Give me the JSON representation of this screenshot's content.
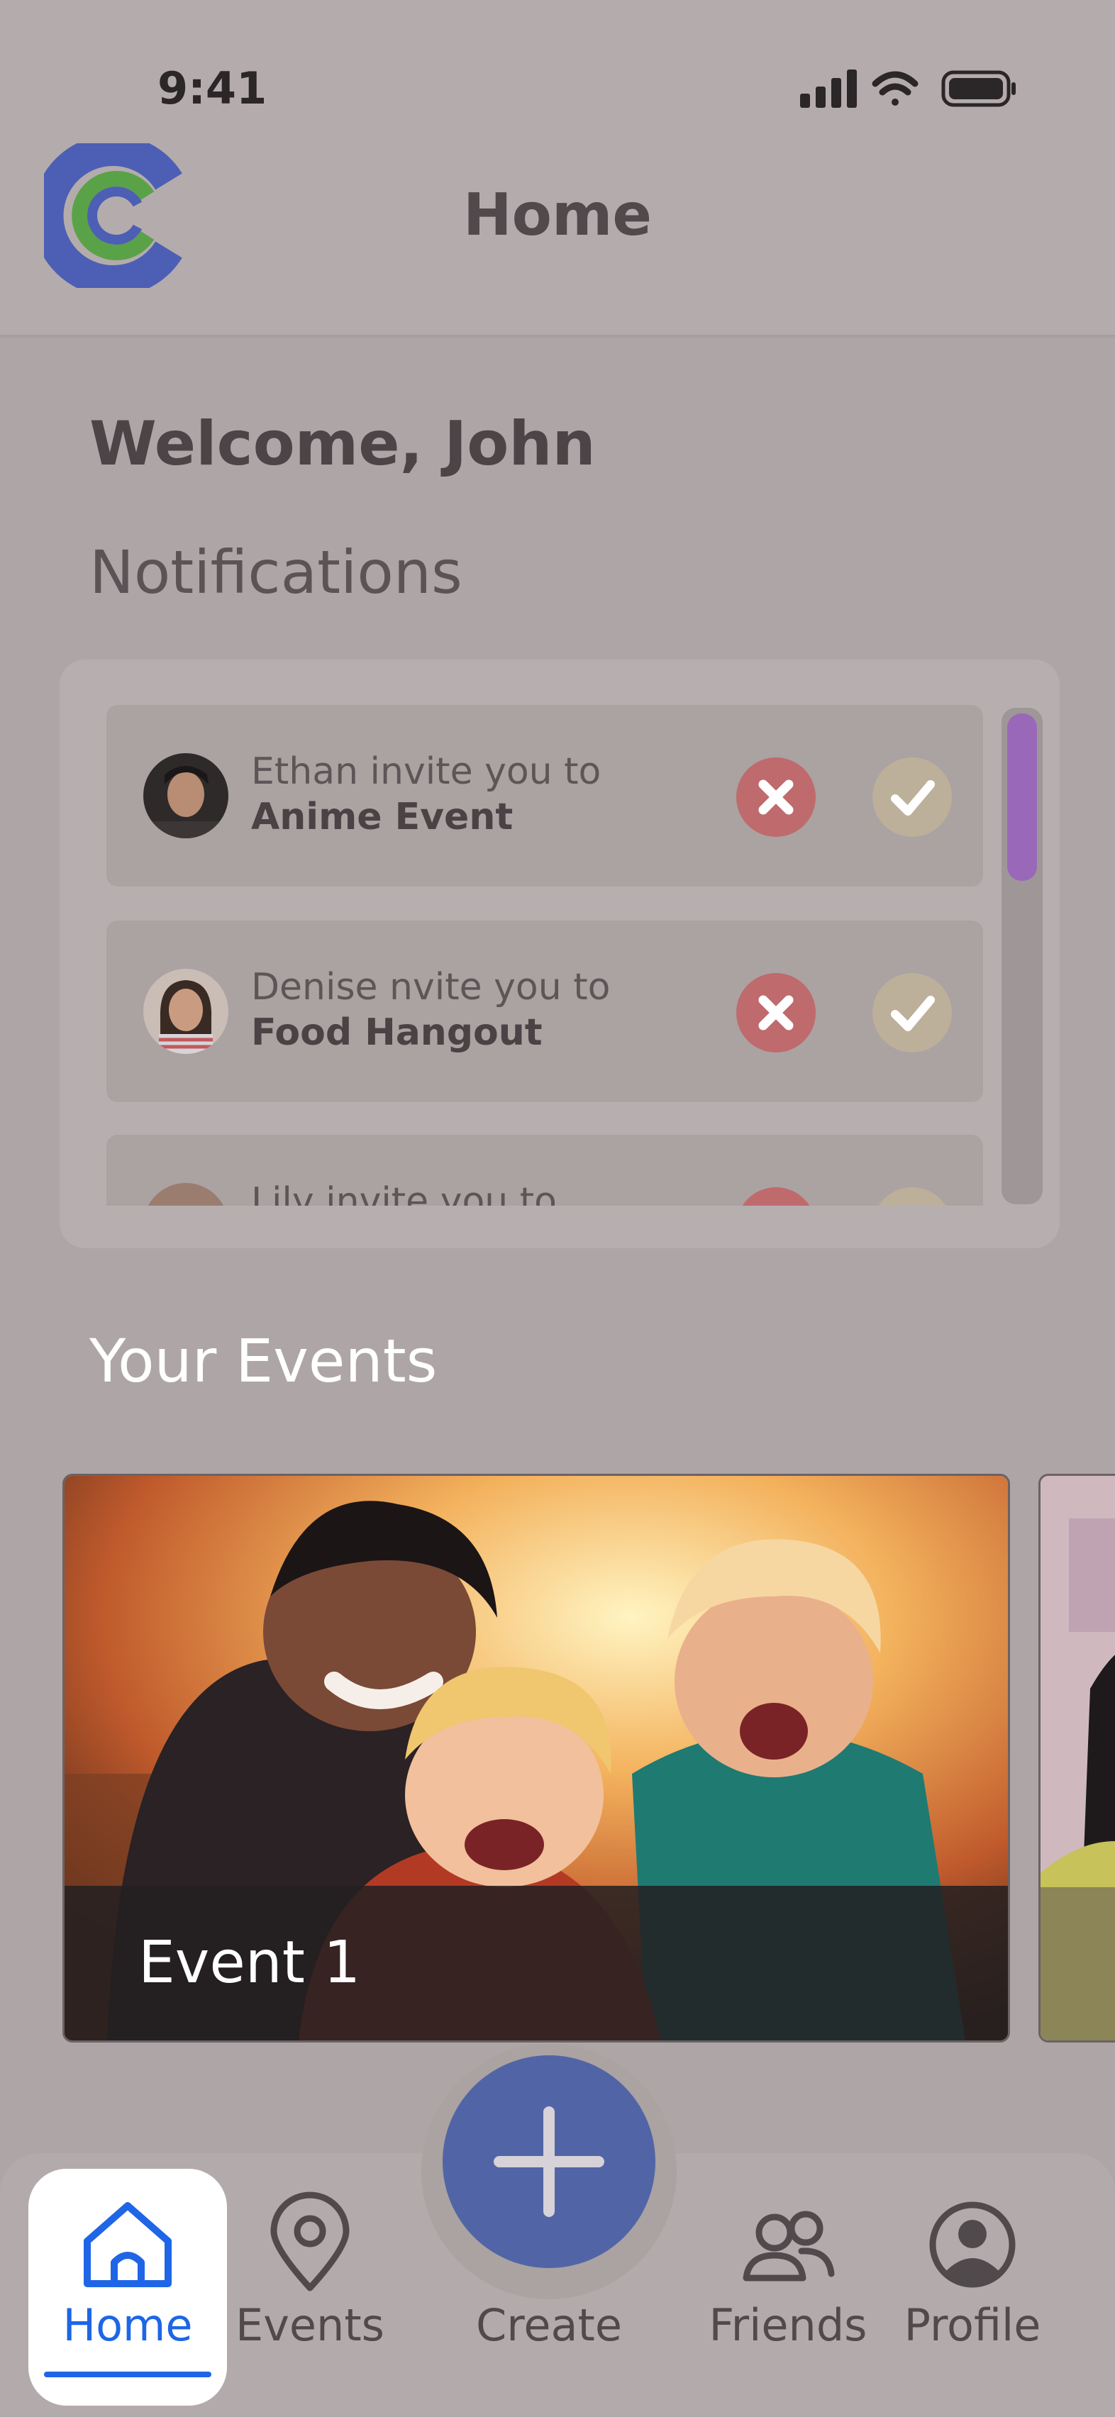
{
  "status_bar": {
    "time": "9:41"
  },
  "header": {
    "title": "Home"
  },
  "welcome": {
    "text": "Welcome, John"
  },
  "notifications": {
    "title": "Notifications",
    "items": [
      {
        "line1": "Ethan invite you to",
        "line2": "Anime Event"
      },
      {
        "line1": "Denise nvite you to",
        "line2": "Food Hangout"
      },
      {
        "line1": "Lily invite you to",
        "line2": ""
      }
    ]
  },
  "events": {
    "title": "Your Events",
    "cards": [
      {
        "label": "Event 1"
      }
    ]
  },
  "nav": {
    "items": [
      {
        "label": "Home",
        "icon": "home-icon",
        "active": true
      },
      {
        "label": "Events",
        "icon": "map-pin-icon"
      },
      {
        "label": "Create",
        "icon": "plus-icon"
      },
      {
        "label": "Friends",
        "icon": "friends-icon"
      },
      {
        "label": "Profile",
        "icon": "profile-icon"
      }
    ]
  },
  "colors": {
    "accent_blue": "#1e66e6",
    "fab": "#5165a6",
    "decline": "#bf6a6c",
    "accept": "#bcb09a",
    "scroll_thumb": "#9a68b8",
    "logo_blue": "#4d5fb4",
    "logo_green": "#5aa247"
  }
}
